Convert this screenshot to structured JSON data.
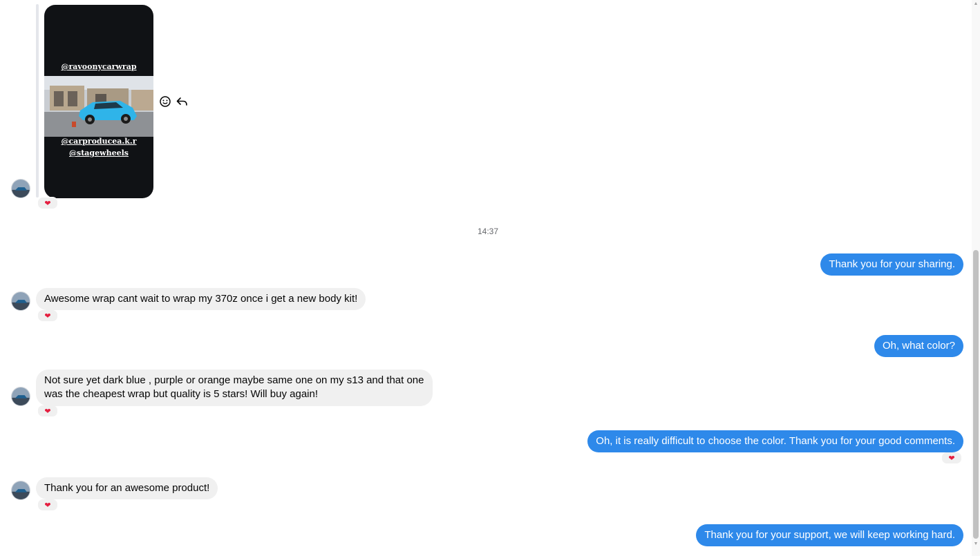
{
  "story": {
    "handle_top": "@ravoonycarwrap",
    "handle_mid": "@carproducea.k.r",
    "handle_bottom": "@stagewheels"
  },
  "timestamp": "14:37",
  "messages": [
    {
      "side": "out",
      "text": "Thank you for your sharing."
    },
    {
      "side": "in",
      "text": "Awesome wrap cant wait to wrap my 370z once i get a new body kit!"
    },
    {
      "side": "out",
      "text": "Oh, what color?"
    },
    {
      "side": "in",
      "line1": "Not sure yet dark blue , purple or orange maybe same one on my s13 and that one",
      "line2": "was the cheapest wrap but quality is 5 stars! Will buy again!"
    },
    {
      "side": "out",
      "text": "Oh, it is really difficult to choose the color. Thank you for your good comments."
    },
    {
      "side": "in",
      "text": "Thank you for an awesome product!"
    },
    {
      "side": "out",
      "text": "Thank you for your support, we will keep working hard."
    }
  ],
  "reaction": "❤",
  "icons": {
    "react": "smiley-icon",
    "reply": "reply-arrow-icon",
    "reaction": "heart-icon"
  },
  "colors": {
    "outgoing_bubble": "#2e89ea",
    "incoming_bubble": "#f0f0f0",
    "heart": "#e41e3f"
  }
}
